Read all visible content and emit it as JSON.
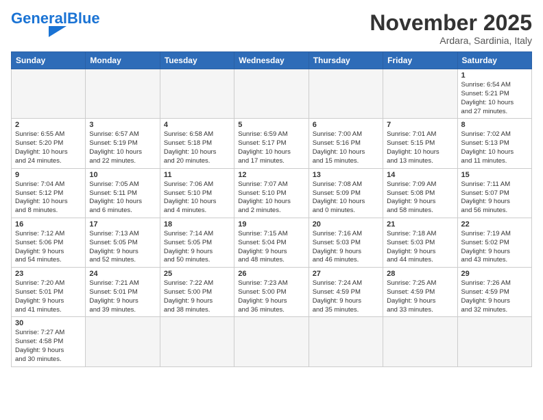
{
  "header": {
    "logo_general": "General",
    "logo_blue": "Blue",
    "month_title": "November 2025",
    "subtitle": "Ardara, Sardinia, Italy"
  },
  "weekdays": [
    "Sunday",
    "Monday",
    "Tuesday",
    "Wednesday",
    "Thursday",
    "Friday",
    "Saturday"
  ],
  "weeks": [
    [
      {
        "day": "",
        "info": ""
      },
      {
        "day": "",
        "info": ""
      },
      {
        "day": "",
        "info": ""
      },
      {
        "day": "",
        "info": ""
      },
      {
        "day": "",
        "info": ""
      },
      {
        "day": "",
        "info": ""
      },
      {
        "day": "1",
        "info": "Sunrise: 6:54 AM\nSunset: 5:21 PM\nDaylight: 10 hours\nand 27 minutes."
      }
    ],
    [
      {
        "day": "2",
        "info": "Sunrise: 6:55 AM\nSunset: 5:20 PM\nDaylight: 10 hours\nand 24 minutes."
      },
      {
        "day": "3",
        "info": "Sunrise: 6:57 AM\nSunset: 5:19 PM\nDaylight: 10 hours\nand 22 minutes."
      },
      {
        "day": "4",
        "info": "Sunrise: 6:58 AM\nSunset: 5:18 PM\nDaylight: 10 hours\nand 20 minutes."
      },
      {
        "day": "5",
        "info": "Sunrise: 6:59 AM\nSunset: 5:17 PM\nDaylight: 10 hours\nand 17 minutes."
      },
      {
        "day": "6",
        "info": "Sunrise: 7:00 AM\nSunset: 5:16 PM\nDaylight: 10 hours\nand 15 minutes."
      },
      {
        "day": "7",
        "info": "Sunrise: 7:01 AM\nSunset: 5:15 PM\nDaylight: 10 hours\nand 13 minutes."
      },
      {
        "day": "8",
        "info": "Sunrise: 7:02 AM\nSunset: 5:13 PM\nDaylight: 10 hours\nand 11 minutes."
      }
    ],
    [
      {
        "day": "9",
        "info": "Sunrise: 7:04 AM\nSunset: 5:12 PM\nDaylight: 10 hours\nand 8 minutes."
      },
      {
        "day": "10",
        "info": "Sunrise: 7:05 AM\nSunset: 5:11 PM\nDaylight: 10 hours\nand 6 minutes."
      },
      {
        "day": "11",
        "info": "Sunrise: 7:06 AM\nSunset: 5:10 PM\nDaylight: 10 hours\nand 4 minutes."
      },
      {
        "day": "12",
        "info": "Sunrise: 7:07 AM\nSunset: 5:10 PM\nDaylight: 10 hours\nand 2 minutes."
      },
      {
        "day": "13",
        "info": "Sunrise: 7:08 AM\nSunset: 5:09 PM\nDaylight: 10 hours\nand 0 minutes."
      },
      {
        "day": "14",
        "info": "Sunrise: 7:09 AM\nSunset: 5:08 PM\nDaylight: 9 hours\nand 58 minutes."
      },
      {
        "day": "15",
        "info": "Sunrise: 7:11 AM\nSunset: 5:07 PM\nDaylight: 9 hours\nand 56 minutes."
      }
    ],
    [
      {
        "day": "16",
        "info": "Sunrise: 7:12 AM\nSunset: 5:06 PM\nDaylight: 9 hours\nand 54 minutes."
      },
      {
        "day": "17",
        "info": "Sunrise: 7:13 AM\nSunset: 5:05 PM\nDaylight: 9 hours\nand 52 minutes."
      },
      {
        "day": "18",
        "info": "Sunrise: 7:14 AM\nSunset: 5:05 PM\nDaylight: 9 hours\nand 50 minutes."
      },
      {
        "day": "19",
        "info": "Sunrise: 7:15 AM\nSunset: 5:04 PM\nDaylight: 9 hours\nand 48 minutes."
      },
      {
        "day": "20",
        "info": "Sunrise: 7:16 AM\nSunset: 5:03 PM\nDaylight: 9 hours\nand 46 minutes."
      },
      {
        "day": "21",
        "info": "Sunrise: 7:18 AM\nSunset: 5:03 PM\nDaylight: 9 hours\nand 44 minutes."
      },
      {
        "day": "22",
        "info": "Sunrise: 7:19 AM\nSunset: 5:02 PM\nDaylight: 9 hours\nand 43 minutes."
      }
    ],
    [
      {
        "day": "23",
        "info": "Sunrise: 7:20 AM\nSunset: 5:01 PM\nDaylight: 9 hours\nand 41 minutes."
      },
      {
        "day": "24",
        "info": "Sunrise: 7:21 AM\nSunset: 5:01 PM\nDaylight: 9 hours\nand 39 minutes."
      },
      {
        "day": "25",
        "info": "Sunrise: 7:22 AM\nSunset: 5:00 PM\nDaylight: 9 hours\nand 38 minutes."
      },
      {
        "day": "26",
        "info": "Sunrise: 7:23 AM\nSunset: 5:00 PM\nDaylight: 9 hours\nand 36 minutes."
      },
      {
        "day": "27",
        "info": "Sunrise: 7:24 AM\nSunset: 4:59 PM\nDaylight: 9 hours\nand 35 minutes."
      },
      {
        "day": "28",
        "info": "Sunrise: 7:25 AM\nSunset: 4:59 PM\nDaylight: 9 hours\nand 33 minutes."
      },
      {
        "day": "29",
        "info": "Sunrise: 7:26 AM\nSunset: 4:59 PM\nDaylight: 9 hours\nand 32 minutes."
      }
    ],
    [
      {
        "day": "30",
        "info": "Sunrise: 7:27 AM\nSunset: 4:58 PM\nDaylight: 9 hours\nand 30 minutes."
      },
      {
        "day": "",
        "info": ""
      },
      {
        "day": "",
        "info": ""
      },
      {
        "day": "",
        "info": ""
      },
      {
        "day": "",
        "info": ""
      },
      {
        "day": "",
        "info": ""
      },
      {
        "day": "",
        "info": ""
      }
    ]
  ]
}
